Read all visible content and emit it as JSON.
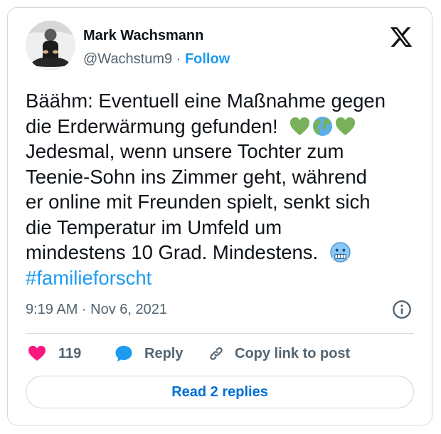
{
  "author": {
    "name": "Mark Wachsmann",
    "handle": "@Wachstum9",
    "separator": " · ",
    "follow_label": "Follow"
  },
  "tweet": {
    "line1": "Bäähm: Eventuell eine Maßnahme gegen",
    "line2": "die Erderwärmung gefunden!",
    "line3": "Jedesmal, wenn unsere Tochter zum",
    "line4": "Teenie-Sohn ins Zimmer geht, während",
    "line5": "er online mit Freunden spielt, senkt sich",
    "line6": "die Temperatur im Umfeld um",
    "line7": "mindestens 10 Grad. Mindestens.",
    "hashtag": "#familieforscht",
    "emojis": [
      "green-heart",
      "globe-americas",
      "green-heart",
      "cold-face"
    ]
  },
  "timestamp": "9:19 AM · Nov 6, 2021",
  "actions": {
    "like_count": "119",
    "reply_label": "Reply",
    "copy_label": "Copy link to post"
  },
  "read_replies_label": "Read 2 replies",
  "colors": {
    "accent": "#1d9bf0",
    "like": "#f91880",
    "text": "#0f1419",
    "secondary": "#536471",
    "border": "#cfd9de",
    "replies_button_text": "#006fd6"
  },
  "icons": [
    "x-logo-icon",
    "info-icon",
    "heart-icon",
    "reply-bubble-icon",
    "link-icon"
  ]
}
